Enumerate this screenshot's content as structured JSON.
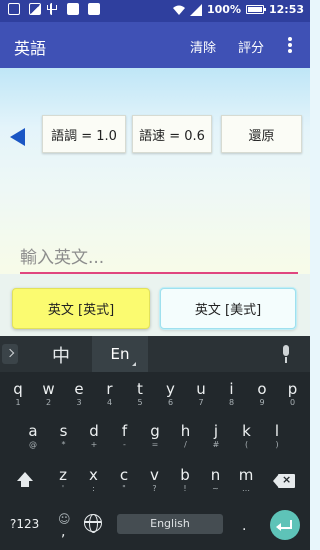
{
  "status_bar": {
    "battery": "100%",
    "battery_level": 1.0,
    "time": "12:53",
    "icons": [
      "message-icon",
      "image-icon",
      "usb-icon",
      "bag-icon",
      "bag-icon",
      "wifi-icon",
      "signal-icon",
      "battery-icon"
    ]
  },
  "app_bar": {
    "title": "英語",
    "clear_label": "清除",
    "rate_label": "評分",
    "menu_icon": "overflow-menu-icon"
  },
  "controls": {
    "back_icon": "back-arrow-icon",
    "tone_label": "語調 = 1.0",
    "speed_label": "語速 = 0.6",
    "reset_label": "還原"
  },
  "input": {
    "placeholder": "輸入英文...",
    "value": ""
  },
  "voice_buttons": {
    "uk_label": "英文 [英式]",
    "us_label": "英文 [美式]"
  },
  "colors": {
    "app_bar": "#3f51b5",
    "status_bar": "#2f3f9e",
    "input_underline": "#e0457f",
    "uk_button": "#fbfb70",
    "enter_key": "#5ec3b8"
  },
  "keyboard": {
    "lang_zh": "中",
    "lang_en": "En",
    "row1": [
      {
        "k": "q",
        "h": "1"
      },
      {
        "k": "w",
        "h": "2"
      },
      {
        "k": "e",
        "h": "3"
      },
      {
        "k": "r",
        "h": "4"
      },
      {
        "k": "t",
        "h": "5"
      },
      {
        "k": "y",
        "h": "6"
      },
      {
        "k": "u",
        "h": "7"
      },
      {
        "k": "i",
        "h": "8"
      },
      {
        "k": "o",
        "h": "9"
      },
      {
        "k": "p",
        "h": "0"
      }
    ],
    "row2": [
      {
        "k": "a",
        "h": "@"
      },
      {
        "k": "s",
        "h": "*"
      },
      {
        "k": "d",
        "h": "+"
      },
      {
        "k": "f",
        "h": "-"
      },
      {
        "k": "g",
        "h": "="
      },
      {
        "k": "h",
        "h": "/"
      },
      {
        "k": "j",
        "h": "#"
      },
      {
        "k": "k",
        "h": "("
      },
      {
        "k": "l",
        "h": ")"
      }
    ],
    "row3": [
      {
        "k": "z",
        "h": "'"
      },
      {
        "k": "x",
        "h": ":"
      },
      {
        "k": "c",
        "h": "\""
      },
      {
        "k": "v",
        "h": "?"
      },
      {
        "k": "b",
        "h": "!"
      },
      {
        "k": "n",
        "h": "~"
      },
      {
        "k": "m",
        "h": "…"
      }
    ],
    "symbols_label": "?123",
    "emoji_hint": "☺",
    "comma": ",",
    "space_label": "English",
    "period": "."
  }
}
